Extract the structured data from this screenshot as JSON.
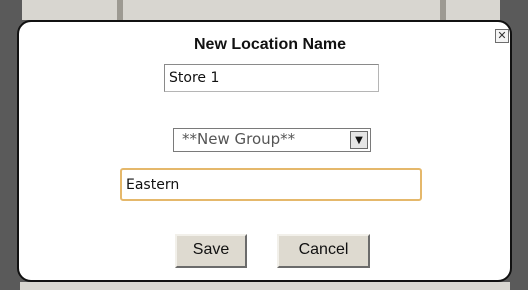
{
  "dialog": {
    "title": "New Location Name",
    "close_icon": "close-icon",
    "location_name_value": "Store 1",
    "group_select_value": "**New Group**",
    "new_group_value": "Eastern",
    "save_label": "Save",
    "cancel_label": "Cancel"
  },
  "colors": {
    "focus_border": "#e5b86b",
    "button_face": "#dedad0",
    "dialog_border": "#111111"
  }
}
